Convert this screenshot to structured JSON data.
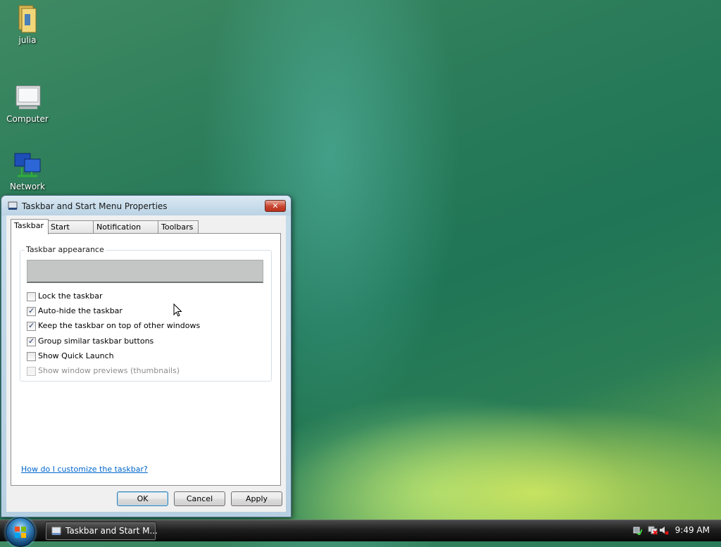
{
  "desktop": {
    "icons": [
      {
        "label": "julia",
        "icon": "user-folder-icon"
      },
      {
        "label": "Computer",
        "icon": "computer-icon"
      },
      {
        "label": "Network",
        "icon": "network-icon"
      }
    ]
  },
  "dialog": {
    "title": "Taskbar and Start Menu Properties",
    "close_label": "✕",
    "tabs": [
      {
        "label": "Taskbar",
        "active": true
      },
      {
        "label": "Start Menu",
        "active": false
      },
      {
        "label": "Notification Area",
        "active": false
      },
      {
        "label": "Toolbars",
        "active": false
      }
    ],
    "group_title": "Taskbar appearance",
    "options": [
      {
        "label": "Lock the taskbar",
        "checked": false,
        "enabled": true
      },
      {
        "label": "Auto-hide the taskbar",
        "checked": true,
        "enabled": true
      },
      {
        "label": "Keep the taskbar on top of other windows",
        "checked": true,
        "enabled": true
      },
      {
        "label": "Group similar taskbar buttons",
        "checked": true,
        "enabled": true
      },
      {
        "label": "Show Quick Launch",
        "checked": false,
        "enabled": true
      },
      {
        "label": "Show window previews (thumbnails)",
        "checked": false,
        "enabled": false
      }
    ],
    "help_link": "How do I customize the taskbar?",
    "buttons": {
      "ok": "OK",
      "cancel": "Cancel",
      "apply": "Apply"
    }
  },
  "taskbar": {
    "task_button_label": "Taskbar and Start M...",
    "clock": "9:49 AM",
    "tray_icons": [
      "safely-remove-hardware-icon",
      "network-disconnected-icon",
      "volume-muted-icon"
    ]
  },
  "colors": {
    "link": "#0066cc",
    "checkmark": "#1f3b70",
    "close_button": "#c8452f"
  }
}
